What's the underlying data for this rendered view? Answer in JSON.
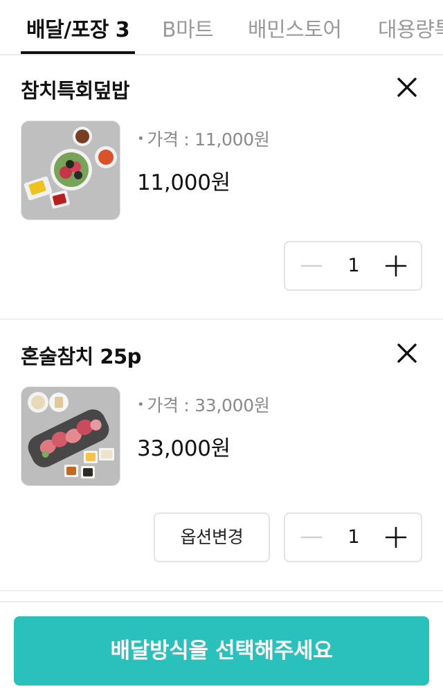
{
  "tabs": [
    {
      "label": "배달/포장 3",
      "active": true
    },
    {
      "label": "B마트",
      "active": false
    },
    {
      "label": "배민스토어",
      "active": false
    },
    {
      "label": "대용량특",
      "active": false
    }
  ],
  "cart_items": [
    {
      "name": "참치특회덮밥",
      "price_label": "가격 : 11,000원",
      "total": "11,000원",
      "quantity": "1",
      "remove_icon": "close-icon",
      "image_desc": "tuna-sashimi-rice-bowl"
    },
    {
      "name": "혼술참치 25p",
      "price_label": "가격 : 33,000원",
      "total": "33,000원",
      "quantity": "1",
      "option_button": "옵션변경",
      "remove_icon": "close-icon",
      "image_desc": "tuna-sashimi-platter"
    }
  ],
  "bottom": {
    "cta_label": "배달방식을 선택해주세요"
  },
  "colors": {
    "accent": "#2ac1bc",
    "text_primary": "#111111",
    "text_secondary": "#8a8a8a",
    "border": "#e3e3e3",
    "minus_disabled": "#d0d0d0"
  }
}
